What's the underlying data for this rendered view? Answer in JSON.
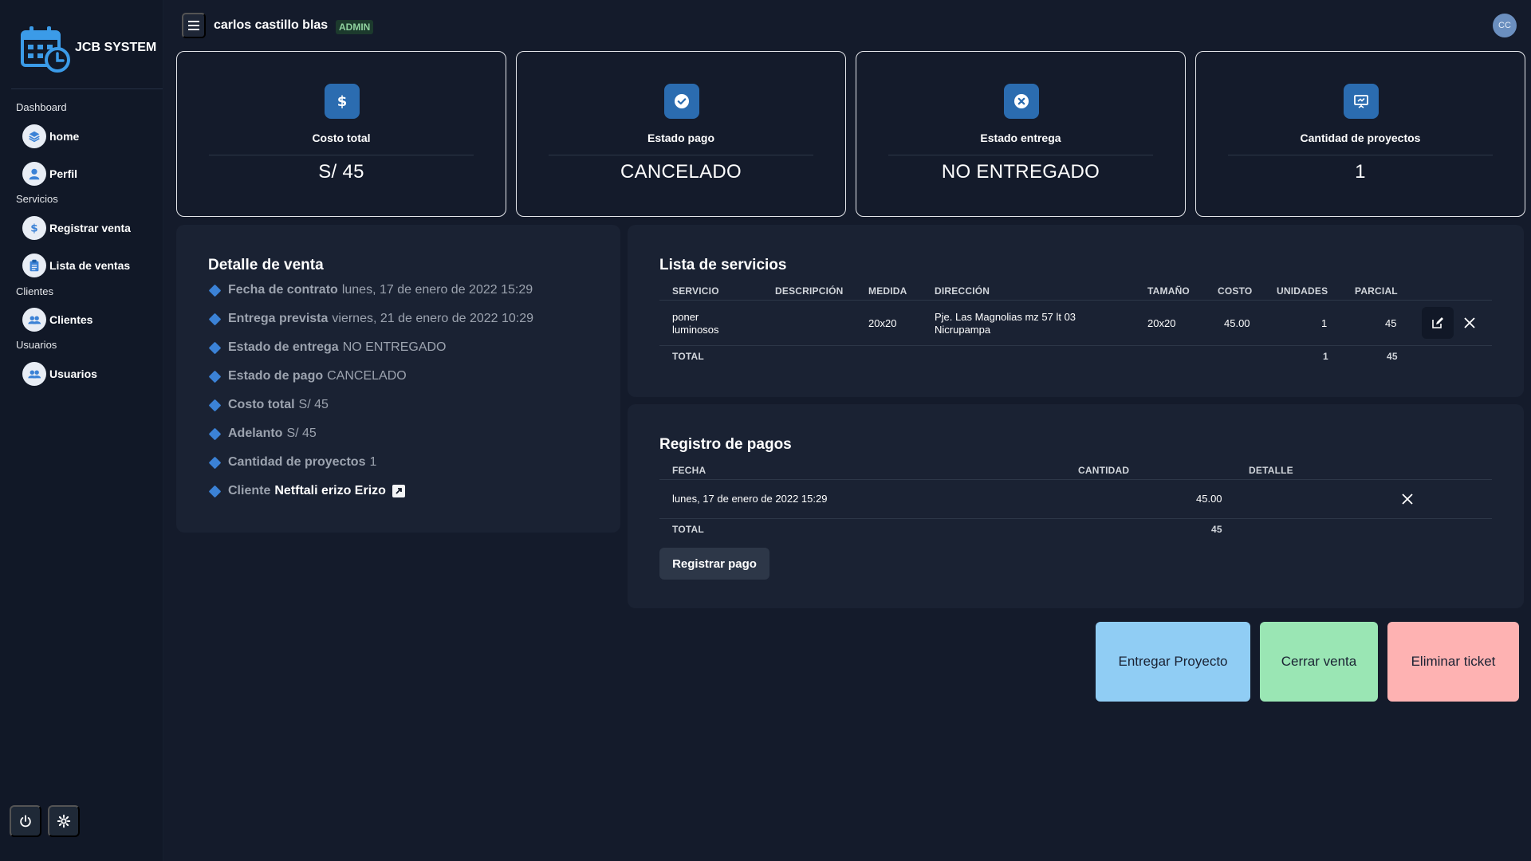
{
  "brand": {
    "name": "JCB SYSTEM"
  },
  "sidebar": {
    "sections": [
      {
        "label": "Dashboard",
        "items": [
          {
            "label": "home",
            "icon": "layers-icon"
          },
          {
            "label": "Perfil",
            "icon": "user-icon"
          }
        ]
      },
      {
        "label": "Servicios",
        "items": [
          {
            "label": "Registrar venta",
            "icon": "dollar-icon"
          },
          {
            "label": "Lista de ventas",
            "icon": "clipboard-icon"
          }
        ]
      },
      {
        "label": "Clientes",
        "items": [
          {
            "label": "Clientes",
            "icon": "users-icon"
          }
        ]
      },
      {
        "label": "Usuarios",
        "items": [
          {
            "label": "Usuarios",
            "icon": "users-icon"
          }
        ]
      }
    ]
  },
  "header": {
    "user_name": "carlos castillo blas",
    "role_badge": "ADMIN",
    "avatar_initials": "CC"
  },
  "stats": [
    {
      "title": "Costo total",
      "value": "S/ 45",
      "icon": "dollar-icon"
    },
    {
      "title": "Estado pago",
      "value": "CANCELADO",
      "icon": "check-circle-icon"
    },
    {
      "title": "Estado entrega",
      "value": "NO ENTREGADO",
      "icon": "x-circle-icon"
    },
    {
      "title": "Cantidad de proyectos",
      "value": "1",
      "icon": "presentation-icon"
    }
  ],
  "detail": {
    "title": "Detalle de venta",
    "rows": [
      {
        "key": "Fecha de contrato",
        "value": "lunes, 17 de enero de 2022 15:29"
      },
      {
        "key": "Entrega prevista",
        "value": "viernes, 21 de enero de 2022 10:29"
      },
      {
        "key": "Estado de entrega",
        "value": "NO ENTREGADO"
      },
      {
        "key": "Estado de pago",
        "value": "CANCELADO"
      },
      {
        "key": "Costo total",
        "value": "S/ 45"
      },
      {
        "key": "Adelanto",
        "value": "S/ 45"
      },
      {
        "key": "Cantidad de proyectos",
        "value": "1"
      }
    ],
    "client_key": "Cliente",
    "client_name": "Netftali erizo Erizo"
  },
  "services": {
    "title": "Lista de servicios",
    "headers": [
      "SERVICIO",
      "DESCRIPCIÓN",
      "MEDIDA",
      "DIRECCIÓN",
      "TAMAÑO",
      "COSTO",
      "UNIDADES",
      "PARCIAL"
    ],
    "rows": [
      {
        "servicio_l1": "poner",
        "servicio_l2": "luminosos",
        "descripcion": "",
        "medida": "20x20",
        "direccion_l1": "Pje. Las Magnolias mz 57 lt 03",
        "direccion_l2": "Nicrupampa",
        "tamano": "20x20",
        "costo": "45.00",
        "unidades": "1",
        "parcial": "45"
      }
    ],
    "total_label": "TOTAL",
    "total_unidades": "1",
    "total_parcial": "45"
  },
  "payments": {
    "title": "Registro de pagos",
    "headers": [
      "FECHA",
      "CANTIDAD",
      "DETALLE"
    ],
    "rows": [
      {
        "fecha": "lunes, 17 de enero de 2022 15:29",
        "cantidad": "45.00",
        "detalle": ""
      }
    ],
    "total_label": "TOTAL",
    "total_cantidad": "45",
    "register_button": "Registrar pago"
  },
  "actions": {
    "deliver": {
      "label": "Entregar Proyecto",
      "color": "#90cdf4"
    },
    "close": {
      "label": "Cerrar venta",
      "color": "#9ae6b4"
    },
    "delete": {
      "label": "Eliminar ticket",
      "color": "#feb2b2"
    }
  },
  "colors": {
    "background": "#141b2b",
    "panel": "#1a2233",
    "accent": "#2b6cb0"
  }
}
